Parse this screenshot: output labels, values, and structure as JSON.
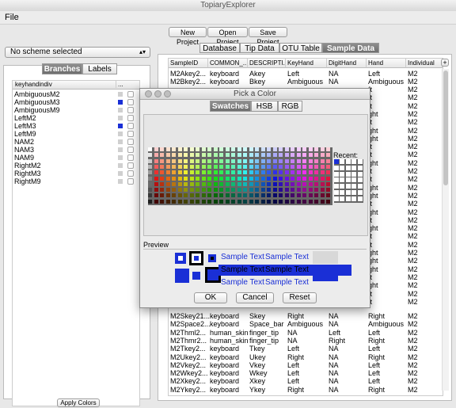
{
  "window": {
    "title": "TopiaryExplorer"
  },
  "menu": {
    "file": "File"
  },
  "toolbar": {
    "new_project": "New Project",
    "open_project": "Open Project",
    "save_project": "Save Project"
  },
  "left": {
    "scheme_select": "No scheme selected",
    "tabs": [
      "Branches",
      "Labels"
    ],
    "column_header": "keyhandindiv",
    "column_more": "...",
    "items": [
      {
        "label": "AmbiguousM2",
        "color": "#d0d0d0"
      },
      {
        "label": "AmbiguousM3",
        "color": "#1a2fd6"
      },
      {
        "label": "AmbiguousM9",
        "color": "#d0d0d0"
      },
      {
        "label": "LeftM2",
        "color": "#d0d0d0"
      },
      {
        "label": "LeftM3",
        "color": "#1a2fd6"
      },
      {
        "label": "LeftM9",
        "color": "#d0d0d0"
      },
      {
        "label": "NAM2",
        "color": "#d0d0d0"
      },
      {
        "label": "NAM3",
        "color": "#d0d0d0"
      },
      {
        "label": "NAM9",
        "color": "#d0d0d0"
      },
      {
        "label": "RightM2",
        "color": "#d0d0d0"
      },
      {
        "label": "RightM3",
        "color": "#d0d0d0"
      },
      {
        "label": "RightM9",
        "color": "#d0d0d0"
      }
    ],
    "apply_button": "Apply Colors"
  },
  "right": {
    "tabs": [
      "Database",
      "Tip Data",
      "OTU Table",
      "Sample Data"
    ],
    "columns": [
      "SampleID",
      "COMMON_...",
      "DESCRIPTI...",
      "KeyHand",
      "DigitHand",
      "Hand",
      "Individual"
    ],
    "add_column": "+",
    "rows_top": [
      [
        "M2Akey2...",
        "keyboard",
        "Akey",
        "Left",
        "NA",
        "Left",
        "M2"
      ],
      [
        "M2Bkey2...",
        "keyboard",
        "Bkey",
        "Ambiguous",
        "NA",
        "Ambiguous",
        "M2"
      ]
    ],
    "rows_right_partial": [
      [
        "ft",
        "M2"
      ],
      [
        "ft",
        "M2"
      ],
      [
        "ft",
        "M2"
      ],
      [
        "ght",
        "M2"
      ],
      [
        "ft",
        "M2"
      ],
      [
        "ght",
        "M2"
      ],
      [
        "ght",
        "M2"
      ],
      [
        "ft",
        "M2"
      ],
      [
        "ft",
        "M2"
      ],
      [
        "ght",
        "M2"
      ],
      [
        "ft",
        "M2"
      ],
      [
        "ft",
        "M2"
      ],
      [
        "ght",
        "M2"
      ],
      [
        "ght",
        "M2"
      ],
      [
        "ft",
        "M2"
      ],
      [
        "ght",
        "M2"
      ],
      [
        "ft",
        "M2"
      ],
      [
        "ght",
        "M2"
      ],
      [
        "ft",
        "M2"
      ],
      [
        "ft",
        "M2"
      ],
      [
        "ght",
        "M2"
      ],
      [
        "ght",
        "M2"
      ],
      [
        "ght",
        "M2"
      ],
      [
        "ft",
        "M2"
      ],
      [
        "ght",
        "M2"
      ],
      [
        "ft",
        "M2"
      ],
      [
        "ft",
        "M2"
      ]
    ],
    "rows_bottom": [
      [
        "M2Skey21...",
        "keyboard",
        "Skey",
        "Right",
        "NA",
        "Right",
        "M2"
      ],
      [
        "M2Space2...",
        "keyboard",
        "Space_bar",
        "Ambiguous",
        "NA",
        "Ambiguous",
        "M2"
      ],
      [
        "M2Thml2...",
        "human_skin",
        "finger_tip",
        "NA",
        "Left",
        "Left",
        "M2"
      ],
      [
        "M2Thmr2...",
        "human_skin",
        "finger_tip",
        "NA",
        "Right",
        "Right",
        "M2"
      ],
      [
        "M2Tkey2...",
        "keyboard",
        "Tkey",
        "Left",
        "NA",
        "Left",
        "M2"
      ],
      [
        "M2Ukey2...",
        "keyboard",
        "Ukey",
        "Right",
        "NA",
        "Right",
        "M2"
      ],
      [
        "M2Vkey2...",
        "keyboard",
        "Vkey",
        "Left",
        "NA",
        "Left",
        "M2"
      ],
      [
        "M2Wkey2...",
        "keyboard",
        "Wkey",
        "Left",
        "NA",
        "Left",
        "M2"
      ],
      [
        "M2Xkey2...",
        "keyboard",
        "Xkey",
        "Left",
        "NA",
        "Left",
        "M2"
      ],
      [
        "M2Ykey2...",
        "keyboard",
        "Ykey",
        "Right",
        "NA",
        "Right",
        "M2"
      ]
    ]
  },
  "dialog": {
    "title": "Pick a Color",
    "tabs": [
      "Swatches",
      "HSB",
      "RGB"
    ],
    "recent_label": "Recent:",
    "preview_label": "Preview",
    "sample_text": "Sample Text",
    "selected_color": "#1a2fd6",
    "buttons": {
      "ok": "OK",
      "cancel": "Cancel",
      "reset": "Reset"
    }
  }
}
